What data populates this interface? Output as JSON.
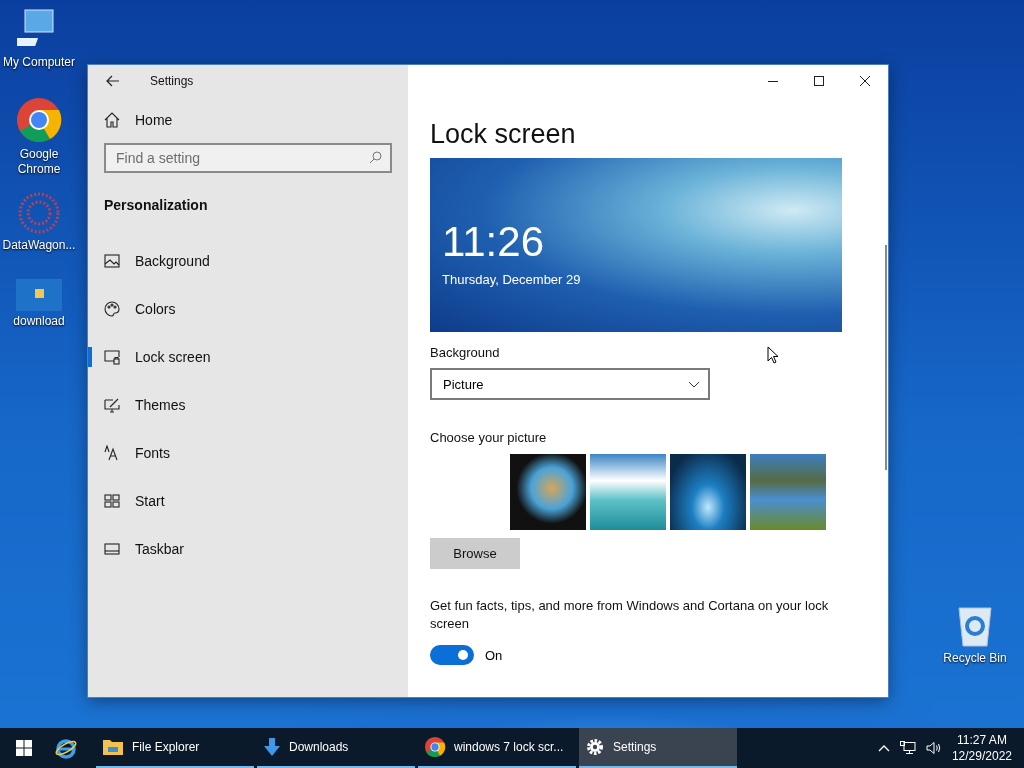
{
  "desktop_icons": [
    {
      "label": "My Computer",
      "kind": "computer"
    },
    {
      "label": "Google Chrome",
      "kind": "chrome"
    },
    {
      "label": "DataWagon...",
      "kind": "app"
    },
    {
      "label": "download",
      "kind": "image"
    },
    {
      "label": "Recycle Bin",
      "kind": "recycle"
    }
  ],
  "window": {
    "title": "Settings",
    "home": "Home",
    "search": {
      "placeholder": "Find a setting"
    },
    "section": "Personalization",
    "nav": [
      {
        "label": "Background",
        "kind": "picture",
        "selected": false
      },
      {
        "label": "Colors",
        "kind": "palette",
        "selected": false
      },
      {
        "label": "Lock screen",
        "kind": "lock",
        "selected": true
      },
      {
        "label": "Themes",
        "kind": "themes",
        "selected": false
      },
      {
        "label": "Fonts",
        "kind": "fonts",
        "selected": false
      },
      {
        "label": "Start",
        "kind": "start",
        "selected": false
      },
      {
        "label": "Taskbar",
        "kind": "taskbar",
        "selected": false
      }
    ],
    "page": {
      "title": "Lock screen",
      "preview_time": "11:26",
      "preview_date": "Thursday, December 29",
      "background_label": "Background",
      "background_value": "Picture",
      "choose_label": "Choose your picture",
      "browse": "Browse",
      "tips_text": "Get fun facts, tips, and more from Windows and Cortana on your lock screen",
      "tips_toggle": {
        "on": true,
        "label": "On"
      }
    }
  },
  "taskbar": {
    "items": [
      {
        "label": "File Explorer",
        "kind": "folder",
        "selected": false
      },
      {
        "label": "Downloads",
        "kind": "download",
        "selected": false
      },
      {
        "label": "windows 7 lock scr...",
        "kind": "chrome",
        "selected": false
      },
      {
        "label": "Settings",
        "kind": "gear",
        "selected": true
      }
    ],
    "time": "11:27 AM",
    "date": "12/29/2022"
  }
}
